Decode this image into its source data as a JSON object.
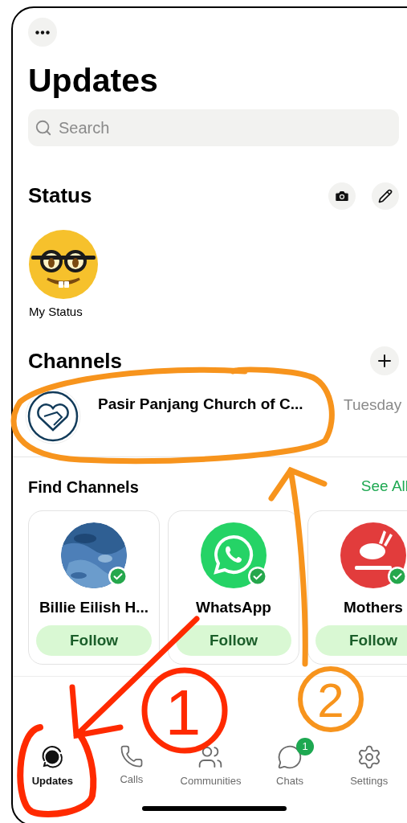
{
  "title": "Updates",
  "search": {
    "placeholder": "Search"
  },
  "status": {
    "title": "Status",
    "my_status": "My Status"
  },
  "channels": {
    "title": "Channels",
    "items": [
      {
        "name": "Pasir Panjang Church of C...",
        "time": "Tuesday"
      }
    ]
  },
  "find_channels": {
    "title": "Find Channels",
    "see_all": "See All",
    "cards": [
      {
        "kind": "picture",
        "name": "Billie Eilish H...",
        "follow": "Follow",
        "verified": true
      },
      {
        "kind": "whatsapp",
        "name": "WhatsApp",
        "follow": "Follow",
        "verified": true
      },
      {
        "kind": "logo",
        "name": "Mothers",
        "follow": "Follow",
        "verified": true
      }
    ]
  },
  "tabs": [
    {
      "kind": "updates",
      "label": "Updates",
      "selected": true
    },
    {
      "kind": "calls",
      "label": "Calls",
      "selected": false
    },
    {
      "kind": "communities",
      "label": "Communities",
      "selected": false
    },
    {
      "kind": "chats",
      "label": "Chats",
      "selected": false,
      "badge": "1"
    },
    {
      "kind": "settings",
      "label": "Settings",
      "selected": false
    }
  ],
  "annotations": [
    {
      "label": "1",
      "color": "#ff2a00"
    },
    {
      "label": "2",
      "color": "#f7941d"
    }
  ]
}
